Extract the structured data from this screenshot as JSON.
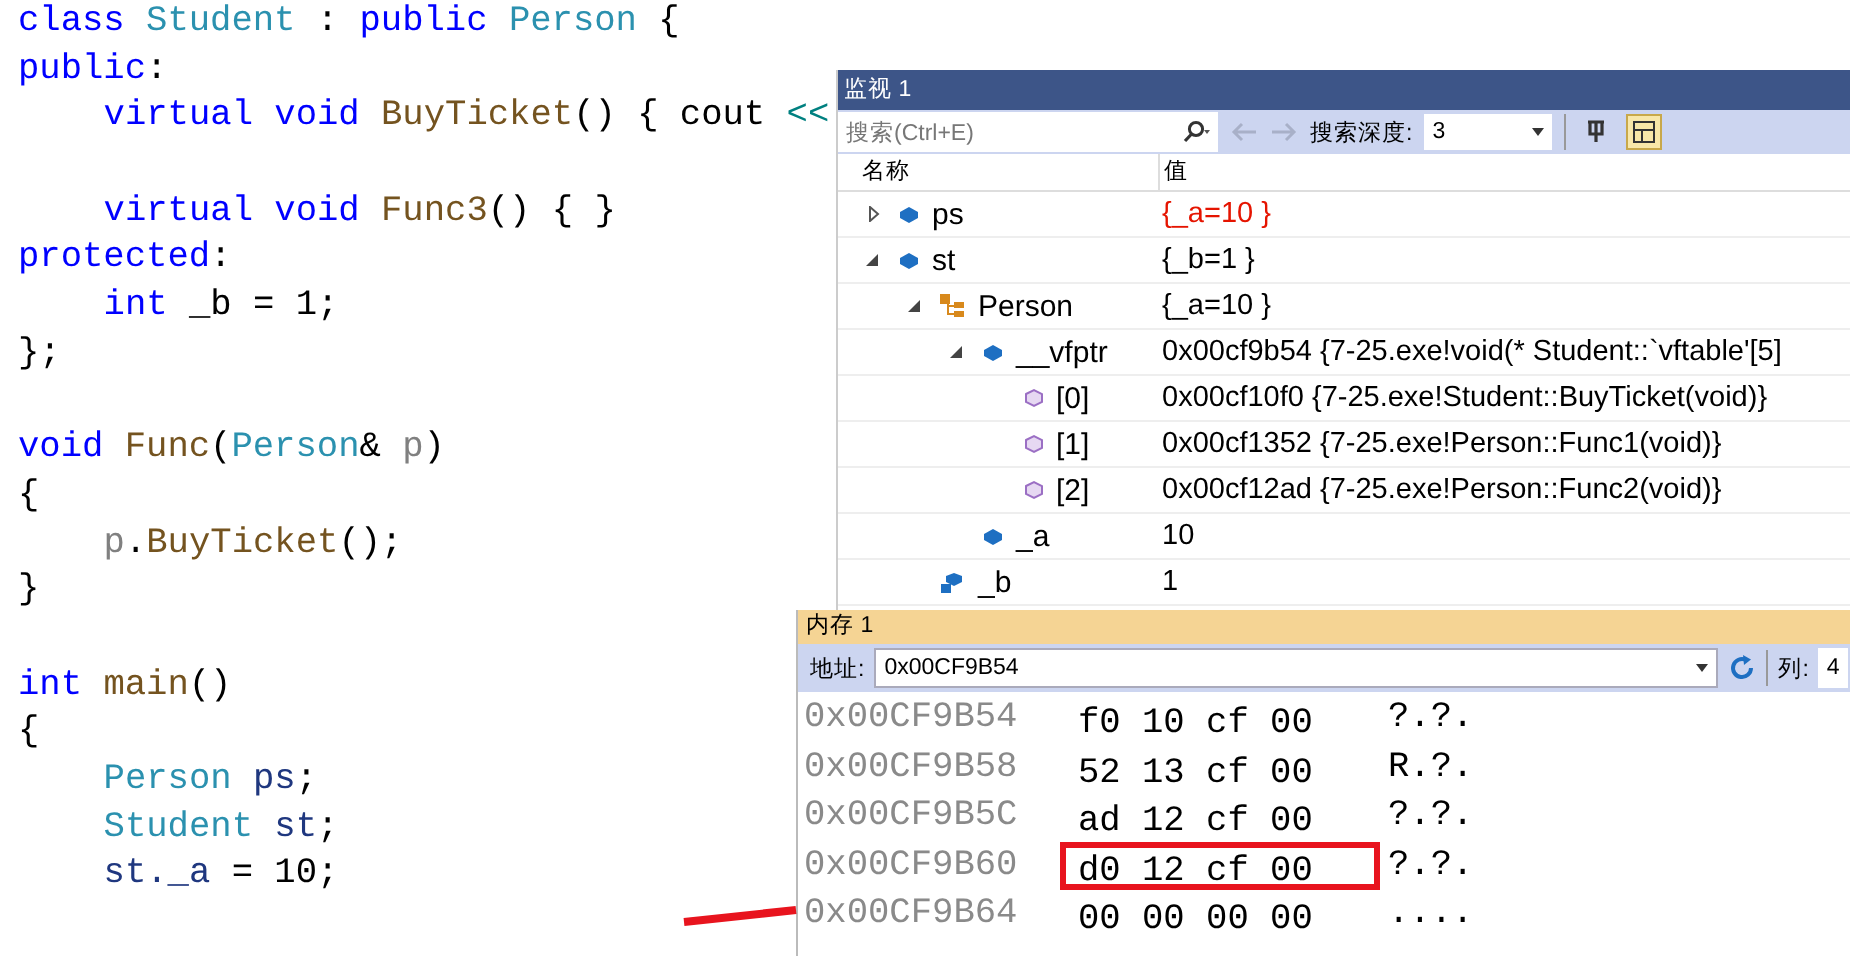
{
  "code": {
    "lines": [
      {
        "indented": false,
        "blank_before": false,
        "tokens": [
          {
            "t": "class ",
            "kind": "kw"
          },
          {
            "t": "Student",
            "kind": "type"
          },
          {
            "t": " : ",
            "kind": "plain"
          },
          {
            "t": "public ",
            "kind": "kw"
          },
          {
            "t": "Person",
            "kind": "type"
          },
          {
            "t": " {",
            "kind": "plain"
          }
        ]
      },
      {
        "indented": false,
        "blank_before": false,
        "tokens": [
          {
            "t": "public",
            "kind": "kw"
          },
          {
            "t": ":",
            "kind": "plain"
          }
        ]
      },
      {
        "indented": true,
        "blank_before": false,
        "tokens": [
          {
            "t": "virtual void ",
            "kind": "kw"
          },
          {
            "t": "BuyTicket",
            "kind": "fn"
          },
          {
            "t": "() { cout ",
            "kind": "plain"
          },
          {
            "t": "<<",
            "kind": "op"
          }
        ]
      },
      {
        "indented": true,
        "blank_before": true,
        "tokens": [
          {
            "t": "virtual void ",
            "kind": "kw"
          },
          {
            "t": "Func3",
            "kind": "fn"
          },
          {
            "t": "() { }",
            "kind": "plain"
          }
        ]
      },
      {
        "indented": false,
        "blank_before": false,
        "tokens": [
          {
            "t": "protected",
            "kind": "kw"
          },
          {
            "t": ":",
            "kind": "plain"
          }
        ]
      },
      {
        "indented": true,
        "blank_before": false,
        "tokens": [
          {
            "t": "int",
            "kind": "kw"
          },
          {
            "t": " _b = 1;",
            "kind": "plain"
          }
        ]
      },
      {
        "indented": false,
        "blank_before": false,
        "tokens": [
          {
            "t": "};",
            "kind": "plain"
          }
        ]
      },
      {
        "indented": false,
        "blank_before": true,
        "tokens": [
          {
            "t": "void ",
            "kind": "kw"
          },
          {
            "t": "Func",
            "kind": "fn"
          },
          {
            "t": "(",
            "kind": "plain"
          },
          {
            "t": "Person",
            "kind": "type"
          },
          {
            "t": "& ",
            "kind": "plain"
          },
          {
            "t": "p",
            "kind": "param"
          },
          {
            "t": ")",
            "kind": "plain"
          }
        ]
      },
      {
        "indented": false,
        "blank_before": false,
        "tokens": [
          {
            "t": "{",
            "kind": "plain"
          }
        ]
      },
      {
        "indented": true,
        "blank_before": false,
        "tokens": [
          {
            "t": "p",
            "kind": "param"
          },
          {
            "t": ".",
            "kind": "plain"
          },
          {
            "t": "BuyTicket",
            "kind": "fn"
          },
          {
            "t": "();",
            "kind": "plain"
          }
        ]
      },
      {
        "indented": false,
        "blank_before": false,
        "tokens": [
          {
            "t": "}",
            "kind": "plain"
          }
        ]
      },
      {
        "indented": false,
        "blank_before": true,
        "tokens": [
          {
            "t": "int ",
            "kind": "kw"
          },
          {
            "t": "main",
            "kind": "fn"
          },
          {
            "t": "()",
            "kind": "plain"
          }
        ]
      },
      {
        "indented": false,
        "blank_before": false,
        "tokens": [
          {
            "t": "{",
            "kind": "plain"
          }
        ]
      },
      {
        "indented": true,
        "blank_before": false,
        "tokens": [
          {
            "t": "Person",
            "kind": "type"
          },
          {
            "t": " ps",
            "kind": "var"
          },
          {
            "t": ";",
            "kind": "plain"
          }
        ]
      },
      {
        "indented": true,
        "blank_before": false,
        "tokens": [
          {
            "t": "Student",
            "kind": "type"
          },
          {
            "t": " st",
            "kind": "var"
          },
          {
            "t": ";",
            "kind": "plain"
          }
        ]
      },
      {
        "indented": true,
        "blank_before": false,
        "tokens": [
          {
            "t": "st._a",
            "kind": "var"
          },
          {
            "t": " = 10;",
            "kind": "plain"
          }
        ]
      }
    ]
  },
  "watch": {
    "title": "监视 1",
    "search": {
      "placeholder": "搜索(Ctrl+E)"
    },
    "depth_label": "搜索深度:",
    "depth": "3",
    "toolbar_buttons": [
      {
        "kind": "pin",
        "selected": false
      },
      {
        "kind": "grid",
        "selected": true
      }
    ],
    "columns": [
      "名称",
      "值"
    ],
    "rows": [
      {
        "name": "ps",
        "value": "{_a=10 }",
        "kind": "field",
        "changed": true,
        "expanded": false
      },
      {
        "name": "st",
        "value": "{_b=1 }",
        "kind": "field",
        "changed": false,
        "expanded": true,
        "children": [
          {
            "name": "Person",
            "value": "{_a=10 }",
            "kind": "base_class",
            "changed": false,
            "expanded": true,
            "children": [
              {
                "name": "__vfptr",
                "value": "0x00cf9b54 {7-25.exe!void(* Student::`vftable'[5]",
                "kind": "field",
                "changed": false,
                "expanded": true,
                "children": [
                  {
                    "name": "[0]",
                    "value": "0x00cf10f0 {7-25.exe!Student::BuyTicket(void)}",
                    "kind": "vtable_entry",
                    "changed": false
                  },
                  {
                    "name": "[1]",
                    "value": "0x00cf1352 {7-25.exe!Person::Func1(void)}",
                    "kind": "vtable_entry",
                    "changed": false
                  },
                  {
                    "name": "[2]",
                    "value": "0x00cf12ad {7-25.exe!Person::Func2(void)}",
                    "kind": "vtable_entry",
                    "changed": false
                  }
                ]
              },
              {
                "name": "_a",
                "value": "10",
                "kind": "field",
                "changed": false
              }
            ]
          },
          {
            "name": "_b",
            "value": "1",
            "kind": "protected_field",
            "changed": false
          }
        ]
      }
    ]
  },
  "memory": {
    "title": "内存 1",
    "address_label": "地址:",
    "address": "0x00CF9B54",
    "columns_label": "列:",
    "columns": "4",
    "rows": [
      {
        "address": "0x00CF9B54",
        "bytes": "f0 10 cf 00",
        "ascii": "?.?.",
        "highlighted": false
      },
      {
        "address": "0x00CF9B58",
        "bytes": "52 13 cf 00",
        "ascii": "R.?.",
        "highlighted": false
      },
      {
        "address": "0x00CF9B5C",
        "bytes": "ad 12 cf 00",
        "ascii": "?.?.",
        "highlighted": false
      },
      {
        "address": "0x00CF9B60",
        "bytes": "d0 12 cf 00",
        "ascii": "?.?.",
        "highlighted": true
      },
      {
        "address": "0x00CF9B64",
        "bytes": "00 00 00 00",
        "ascii": "....",
        "highlighted": false
      }
    ]
  }
}
